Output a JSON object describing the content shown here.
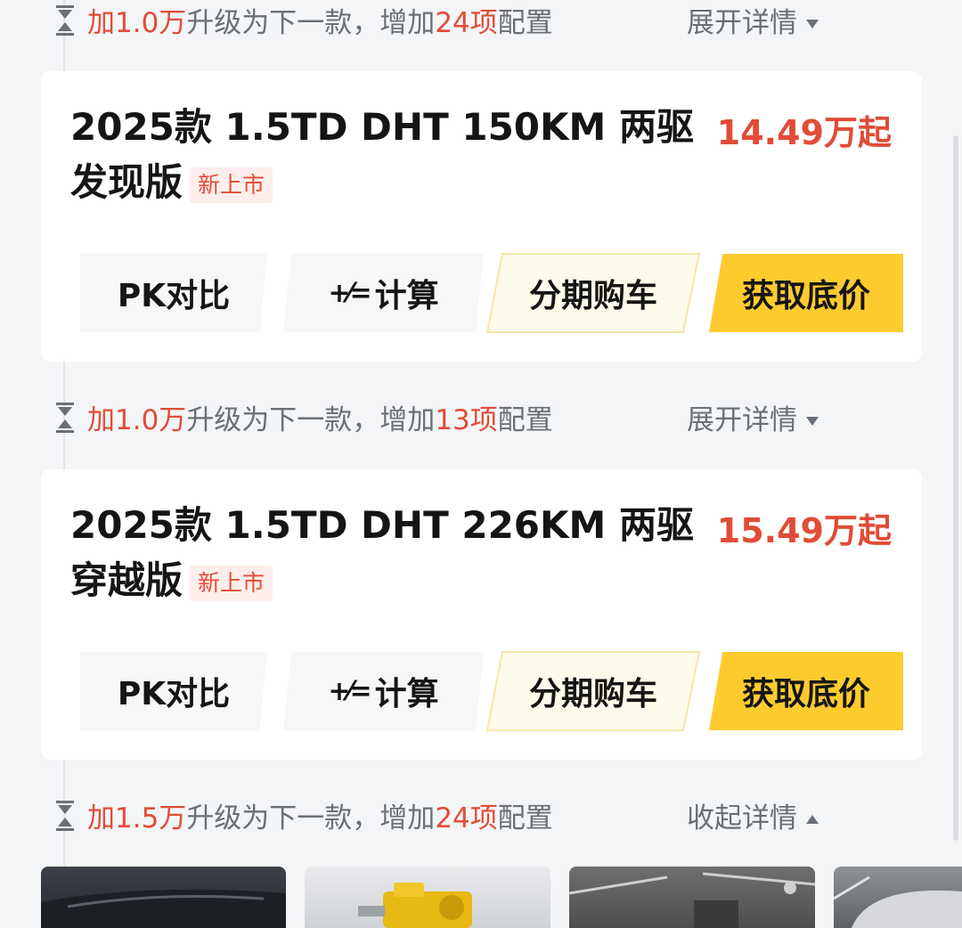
{
  "upgrades": [
    {
      "prefix": "加",
      "amount": "1.0万",
      "middle": "升级为下一款，增加",
      "count": "24项",
      "suffix": "配置",
      "toggle": "展开详情"
    },
    {
      "prefix": "加",
      "amount": "1.0万",
      "middle": "升级为下一款，增加",
      "count": "13项",
      "suffix": "配置",
      "toggle": "展开详情"
    },
    {
      "prefix": "加",
      "amount": "1.5万",
      "middle": "升级为下一款，增加",
      "count": "24项",
      "suffix": "配置",
      "toggle": "收起详情"
    }
  ],
  "cards": [
    {
      "title": "2025款 1.5TD DHT 150KM 两驱发现版",
      "badge": "新上市",
      "price": "14.49万起"
    },
    {
      "title": "2025款 1.5TD DHT 226KM 两驱穿越版",
      "badge": "新上市",
      "price": "15.49万起"
    }
  ],
  "buttons": {
    "pk": "PK对比",
    "calc_icon": "+⁄=",
    "calc": "计算",
    "loan": "分期购车",
    "price": "获取底价"
  },
  "colors": {
    "accent_red": "#e14c36",
    "accent_yellow": "#fecb2f",
    "loan_bg": "#fffbea"
  },
  "icons": {
    "upgrade": "hourglass-icon",
    "expand": "caret-down-icon",
    "collapse": "caret-up-icon"
  }
}
